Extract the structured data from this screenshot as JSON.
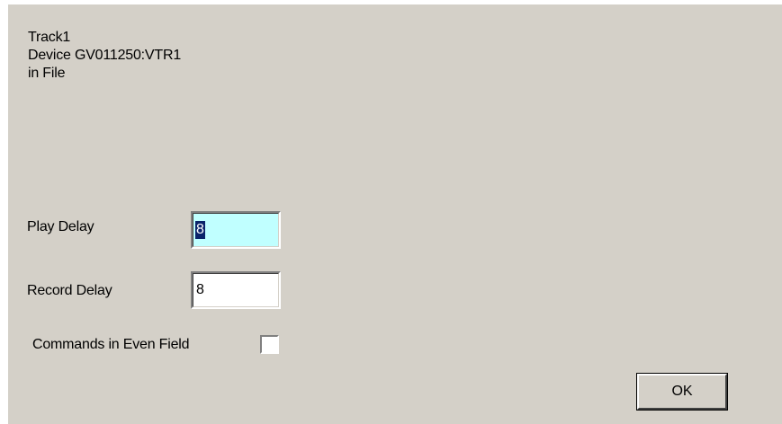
{
  "info": {
    "track": "Track1",
    "device": "Device GV011250:VTR1",
    "location": "in File"
  },
  "play_delay": {
    "label": "Play Delay",
    "value": "8",
    "focused": true,
    "field_bg": "#c0ffff"
  },
  "record_delay": {
    "label": "Record Delay",
    "value": "8",
    "field_bg": "#ffffff"
  },
  "commands_even_field": {
    "label": "Commands in Even Field",
    "checked": false
  },
  "ok_button": {
    "label": "OK"
  },
  "colors": {
    "dialog_bg": "#d4d0c8",
    "selection_bg": "#0a246a"
  }
}
